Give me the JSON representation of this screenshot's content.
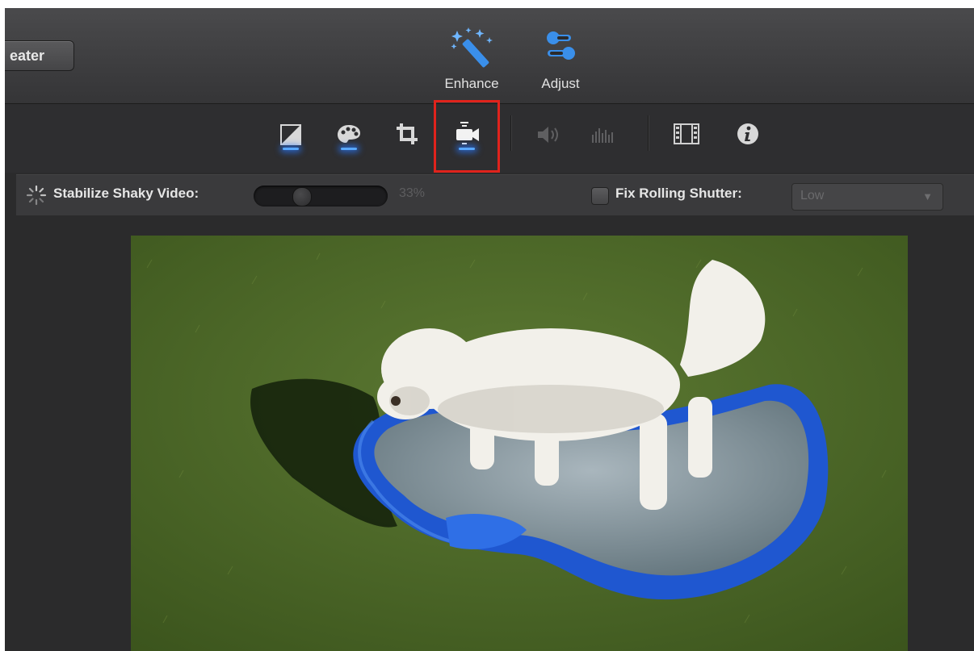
{
  "toolbar": {
    "theater_label": "eater",
    "enhance_label": "Enhance",
    "adjust_label": "Adjust"
  },
  "adjust_bar": {
    "buttons": [
      {
        "name": "color-balance-icon"
      },
      {
        "name": "color-correction-icon"
      },
      {
        "name": "crop-icon"
      },
      {
        "name": "stabilization-icon",
        "selected": true
      },
      {
        "name": "volume-icon"
      },
      {
        "name": "noise-reduction-icon"
      },
      {
        "name": "speed-icon"
      },
      {
        "name": "info-icon"
      }
    ]
  },
  "stabilize": {
    "label": "Stabilize Shaky Video:",
    "percent": "33%",
    "level": 0.33
  },
  "rolling_shutter": {
    "label": "Fix Rolling Shutter:",
    "value": "Low",
    "checked": false
  },
  "colors": {
    "accent": "#58a8ff",
    "highlight": "#e0231c"
  }
}
